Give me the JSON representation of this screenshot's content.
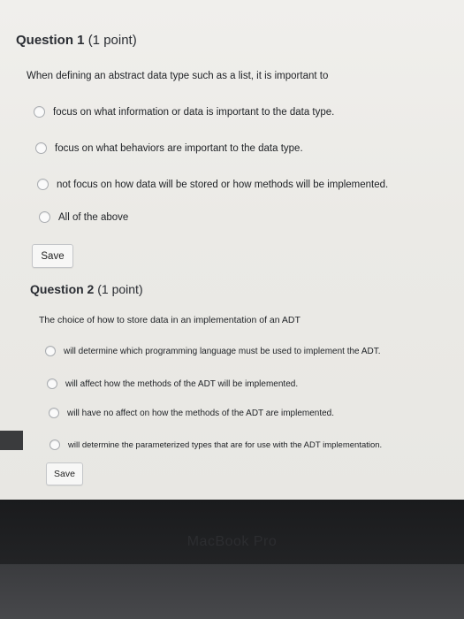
{
  "questions": [
    {
      "number": "Question 1",
      "points": "(1 point)",
      "prompt": "When defining an abstract data type such as a list, it is important to",
      "options": [
        "focus on what information or data is important to the data type.",
        "focus on what behaviors are important to the data type.",
        "not focus on how data will be stored or how methods will be implemented.",
        "All of the above"
      ],
      "save_label": "Save"
    },
    {
      "number": "Question 2",
      "points": "(1 point)",
      "prompt": "The choice of how to store data in an implementation of an ADT",
      "options": [
        "will determine which programming language must be used to implement the ADT.",
        "will affect how the methods of the ADT will be implemented.",
        "will have no affect on how the methods of the ADT are implemented.",
        "will determine the parameterized types that are for use with the ADT implementation."
      ],
      "save_label": "Save"
    }
  ],
  "device_label": "MacBook Pro"
}
